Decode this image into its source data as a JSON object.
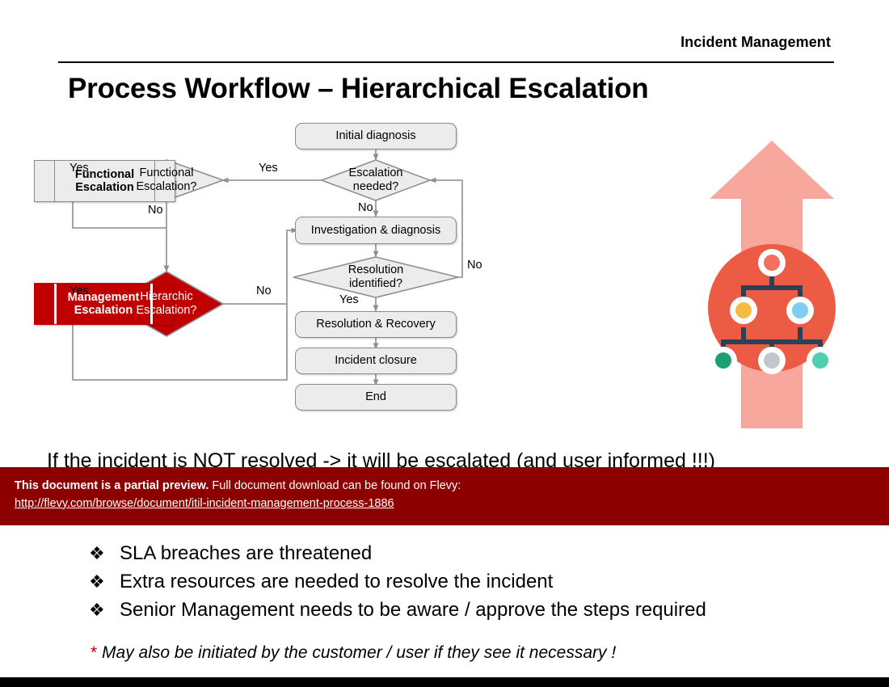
{
  "header": {
    "label": "Incident Management",
    "title": "Process Workflow – Hierarchical Escalation"
  },
  "flowchart": {
    "nodes": {
      "initial_diagnosis": "Initial diagnosis",
      "escalation_needed": "Escalation\nneeded?",
      "escalation_needed_l1": "Escalation",
      "escalation_needed_l2": "needed?",
      "investigation": "Investigation & diagnosis",
      "resolution_identified_l1": "Resolution",
      "resolution_identified_l2": "identified?",
      "resolution_recovery": "Resolution & Recovery",
      "incident_closure": "Incident closure",
      "end": "End",
      "functional_escalation_q_l1": "Functional",
      "functional_escalation_q_l2": "Escalation?",
      "functional_escalation_l1": "Functional",
      "functional_escalation_l2": "Escalation",
      "hierarchic_escalation_q_l1": "Hierarchic",
      "hierarchic_escalation_q_l2": "Escalation?",
      "management_escalation_l1": "Management",
      "management_escalation_l2": "Escalation"
    },
    "edge_labels": {
      "esc_needed_yes": "Yes",
      "esc_needed_no": "No",
      "func_q_yes": "Yes",
      "func_q_no": "No",
      "hier_q_yes": "Yes",
      "hier_q_no": "No",
      "res_id_yes": "Yes",
      "res_id_no": "No"
    },
    "colors": {
      "process_fill": "#ececec",
      "process_stroke": "#8c8c8c",
      "accent_red": "#c00000",
      "connector": "#9a9a9a"
    }
  },
  "graphic": {
    "name": "hierarchy-escalation-arrow",
    "arrow_color": "#f8a79c",
    "circle_color": "#ec5b43",
    "node_colors": [
      "#f4705c",
      "#f5bc41",
      "#7fcdf0",
      "#1f9e74",
      "#c3c7cc",
      "#4fcfae"
    ],
    "connector_color": "#2e4057"
  },
  "body": {
    "intro_line": "If the incident is NOT resolved  ->  it will be escalated (and user informed !!!)",
    "bullets": [
      {
        "mark": "❖",
        "text": "SLA breaches are threatened"
      },
      {
        "mark": "❖",
        "text": "Extra resources are needed to resolve the incident"
      },
      {
        "mark": "❖",
        "text": "Senior Management needs to be aware / approve the steps required"
      }
    ],
    "footnote_star": "*",
    "footnote_text": "May also be initiated by the customer / user if they see it necessary !"
  },
  "preview_banner": {
    "strong": "This document is a partial preview.",
    "rest": "Full document download can be found on Flevy:",
    "url": "http://flevy.com/browse/document/itil-incident-management-process-1886",
    "background": "#8c0000"
  }
}
